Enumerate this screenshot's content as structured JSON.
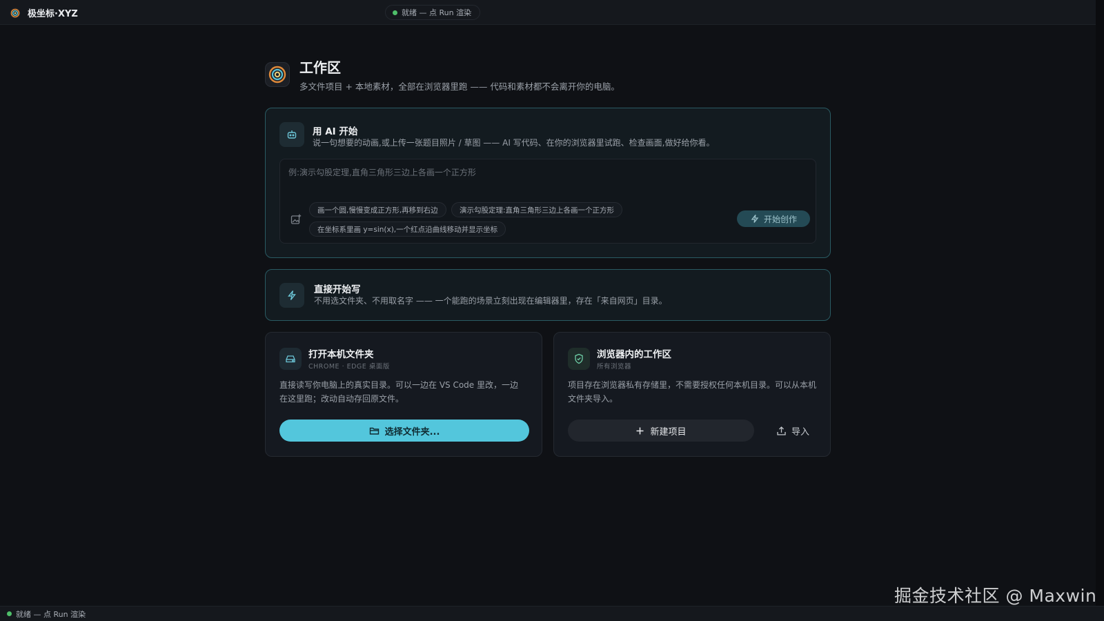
{
  "app": {
    "title": "极坐标·XYZ"
  },
  "topbar": {
    "status": "就绪 — 点 Run 渲染"
  },
  "header": {
    "title": "工作区",
    "subtitle": "多文件项目 + 本地素材，全部在浏览器里跑 —— 代码和素材都不会离开你的电脑。"
  },
  "ai_card": {
    "title": "用 AI 开始",
    "description": "说一句想要的动画,或上传一张题目照片 / 草图 —— AI 写代码、在你的浏览器里试跑、检查画面,做好给你看。",
    "placeholder": "例:演示勾股定理,直角三角形三边上各画一个正方形",
    "chips": [
      "画一个圆,慢慢变成正方形,再移到右边",
      "演示勾股定理:直角三角形三边上各画一个正方形",
      "在坐标系里画 y=sin(x),一个红点沿曲线移动并显示坐标"
    ],
    "start_label": "开始创作"
  },
  "direct_card": {
    "title": "直接开始写",
    "description": "不用选文件夹、不用取名字 —— 一个能跑的场景立刻出现在编辑器里，存在「来自网页」目录。"
  },
  "local_card": {
    "title": "打开本机文件夹",
    "meta": "CHROME · EDGE 桌面版",
    "description": "直接读写你电脑上的真实目录。可以一边在 VS Code 里改，一边在这里跑；改动自动存回原文件。",
    "button_label": "选择文件夹..."
  },
  "browser_card": {
    "title": "浏览器内的工作区",
    "meta": "所有浏览器",
    "description": "项目存在浏览器私有存储里，不需要授权任何本机目录。可以从本机文件夹导入。",
    "new_label": "新建项目",
    "import_label": "导入"
  },
  "bottombar": {
    "status": "就绪 — 点 Run 渲染"
  },
  "watermark": "掘金技术社区 @ Maxwin",
  "colors": {
    "accent": "#53c6dc",
    "status_ok": "#4fbf6a",
    "background": "#0f1115"
  }
}
